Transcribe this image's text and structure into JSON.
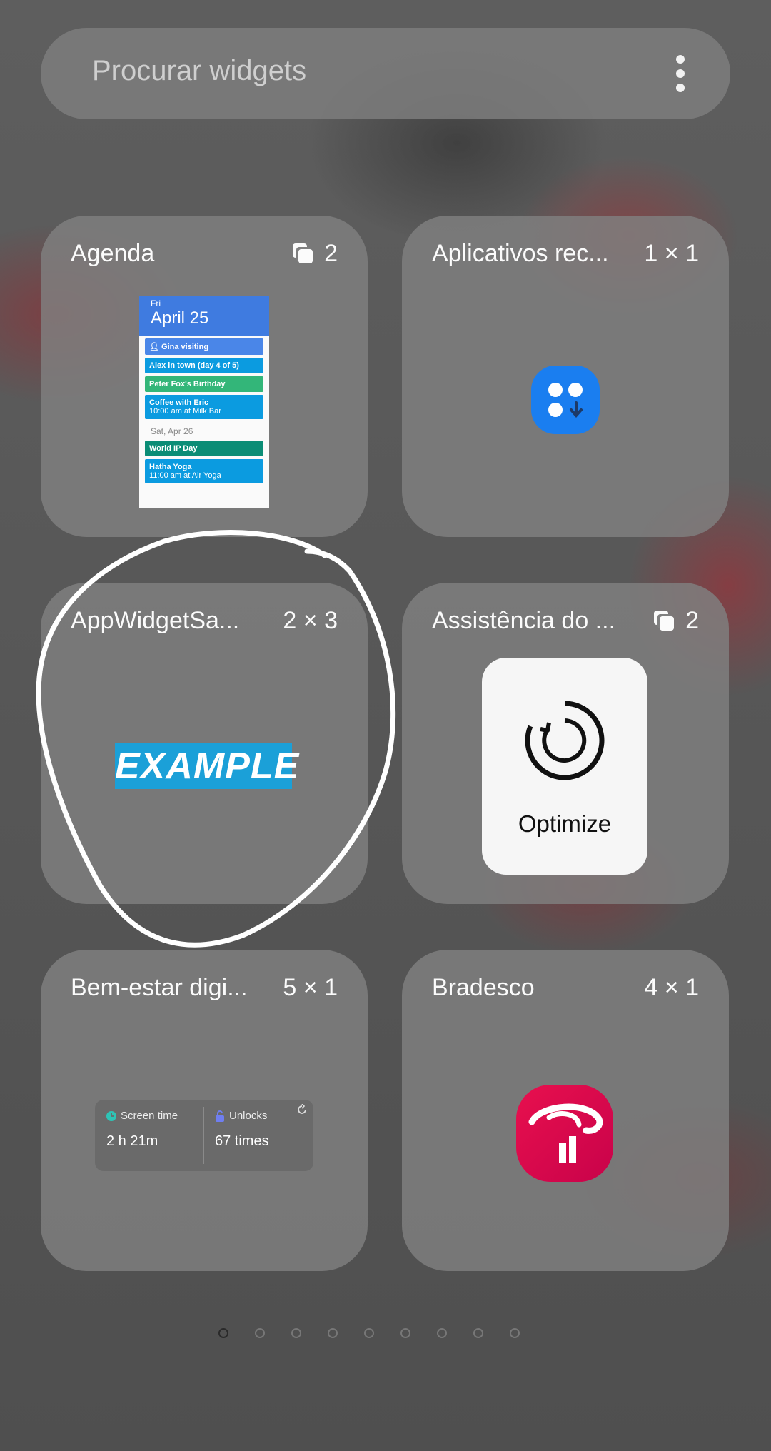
{
  "search": {
    "placeholder": "Procurar widgets",
    "more_icon": "more-vert-icon"
  },
  "widgets": [
    {
      "title": "Agenda",
      "size": "2",
      "size_icon": "stack-icon",
      "preview": {
        "day": "Fri",
        "date": "April 25",
        "events": [
          {
            "title": "Gina visiting",
            "color": "#4a86e8"
          },
          {
            "title": "Alex in town (day 4 of 5)",
            "color": "#0b9be0"
          },
          {
            "title": "Peter Fox's Birthday",
            "color": "#33b679"
          },
          {
            "title": "Coffee with Eric",
            "detail": "10:00 am at Milk Bar",
            "color": "#0b9be0"
          }
        ],
        "second_date": "Sat, Apr 26",
        "events2": [
          {
            "title": "World IP Day",
            "color": "#0b8d76"
          },
          {
            "title": "Hatha Yoga",
            "detail": "11:00 am at Air Yoga",
            "color": "#0b9be0"
          }
        ]
      }
    },
    {
      "title": "Aplicativos rec...",
      "size": "1 × 1",
      "icon": "recent-apps-icon",
      "icon_color": "#1a7ef0"
    },
    {
      "title": "AppWidgetSa...",
      "size": "2 × 3",
      "preview_text": "EXAMPLE"
    },
    {
      "title": "Assistência do ...",
      "size": "2",
      "size_icon": "stack-icon",
      "preview_label": "Optimize",
      "preview_icon": "optimize-refresh-icon"
    },
    {
      "title": "Bem-estar digi...",
      "size": "5 × 1",
      "preview": {
        "screen_time_label": "Screen time",
        "screen_time_value": "2 h 21m",
        "unlocks_label": "Unlocks",
        "unlocks_value": "67 times"
      }
    },
    {
      "title": "Bradesco",
      "size": "4 × 1",
      "icon": "bradesco-logo-icon",
      "icon_color": "#cc0a52"
    }
  ],
  "pager": {
    "count": 9,
    "active": 0
  },
  "annotation_color": "#ffffff"
}
